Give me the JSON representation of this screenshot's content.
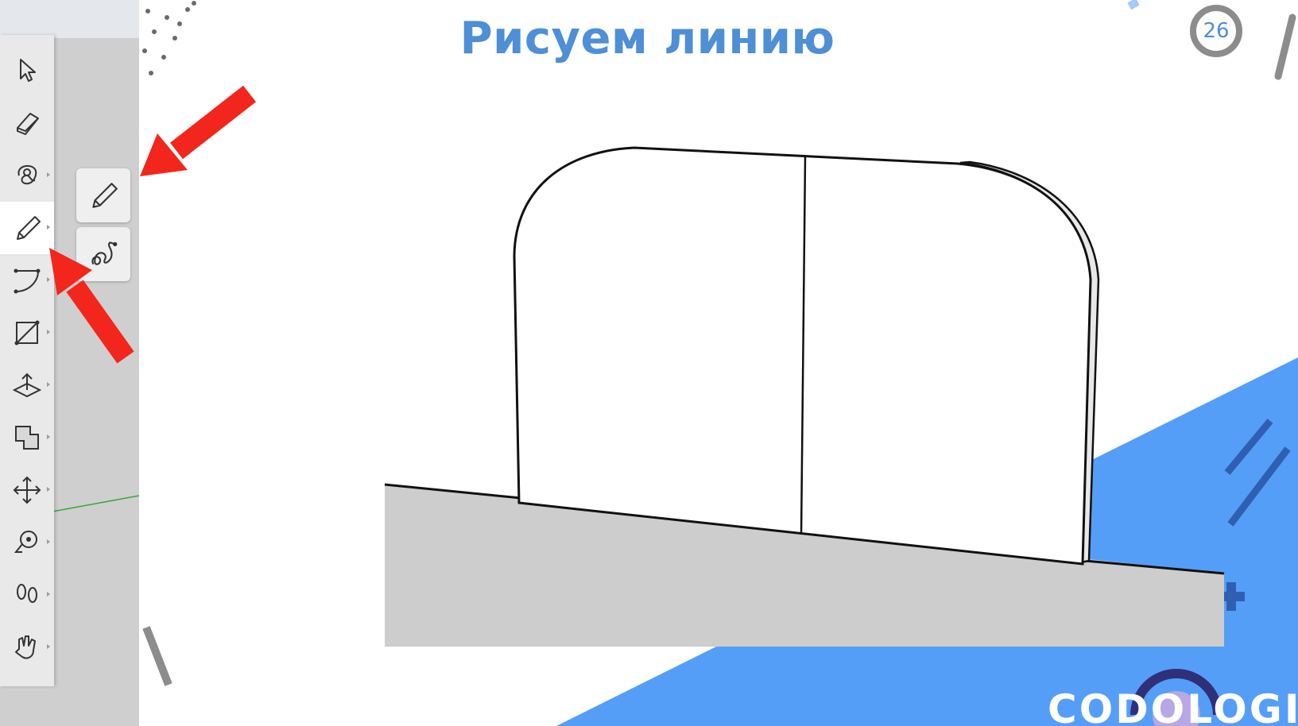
{
  "slide": {
    "title": "Рисуем линию",
    "page_number": "26",
    "logo_text": "CODOLOGIA"
  },
  "toolbar": {
    "tools": [
      {
        "name": "select-tool",
        "icon": "arrow-cursor-icon"
      },
      {
        "name": "eraser-tool",
        "icon": "eraser-icon"
      },
      {
        "name": "paint-bucket-tool",
        "icon": "paint-bucket-icon"
      },
      {
        "name": "line-tool",
        "icon": "pencil-icon",
        "active": true
      },
      {
        "name": "arc-tool",
        "icon": "arc-icon"
      },
      {
        "name": "rectangle-tool",
        "icon": "rectangle-icon"
      },
      {
        "name": "push-pull-tool",
        "icon": "push-pull-icon"
      },
      {
        "name": "offset-tool",
        "icon": "offset-icon"
      },
      {
        "name": "move-tool",
        "icon": "move-icon"
      },
      {
        "name": "tape-measure-tool",
        "icon": "tape-measure-icon"
      },
      {
        "name": "walk-tool",
        "icon": "footprints-icon"
      },
      {
        "name": "pan-tool",
        "icon": "hand-icon"
      }
    ],
    "flyout": [
      {
        "name": "line-option",
        "icon": "pencil-icon"
      },
      {
        "name": "freehand-option",
        "icon": "freehand-icon"
      }
    ]
  },
  "colors": {
    "title": "#4e8fd6",
    "accent_blue": "#559ef7",
    "arrow_red": "#f2261c",
    "toolbar_bg": "#e9e9e9",
    "ground": "#cdcdcd"
  }
}
